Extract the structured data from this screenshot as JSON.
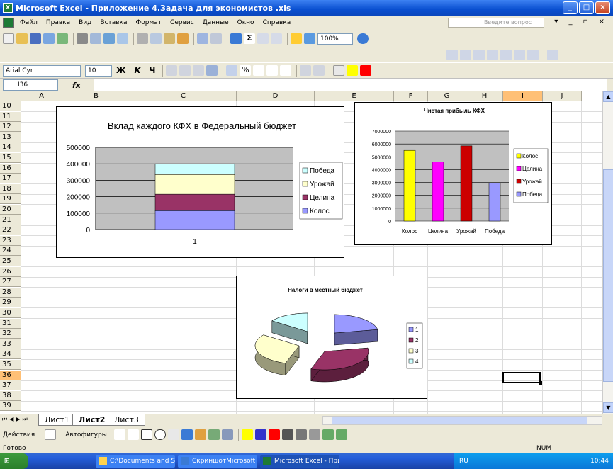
{
  "window": {
    "title": "Microsoft Excel - Приложение 4.Задача для экономистов .xls"
  },
  "menu": {
    "items": [
      "Файл",
      "Правка",
      "Вид",
      "Вставка",
      "Формат",
      "Сервис",
      "Данные",
      "Окно",
      "Справка"
    ],
    "ask_placeholder": "Введите вопрос"
  },
  "toolbar": {
    "zoom": "100%",
    "font_name": "Arial Cyr",
    "font_size": "10",
    "bold": "Ж",
    "italic": "К",
    "underline": "Ч"
  },
  "formula_bar": {
    "cell_ref": "I36",
    "fx": "fx",
    "formula": ""
  },
  "columns": [
    "A",
    "B",
    "C",
    "D",
    "E",
    "F",
    "G",
    "H",
    "I",
    "J"
  ],
  "rows": [
    "10",
    "11",
    "12",
    "13",
    "14",
    "15",
    "16",
    "17",
    "18",
    "19",
    "20",
    "21",
    "22",
    "23",
    "24",
    "25",
    "26",
    "27",
    "28",
    "29",
    "30",
    "31",
    "32",
    "33",
    "34",
    "35",
    "36",
    "37",
    "38",
    "39"
  ],
  "selected_cell": {
    "column": "I",
    "row": "36"
  },
  "sheets": {
    "tabs": [
      "Лист1",
      "Лист2",
      "Лист3"
    ],
    "active": "Лист2"
  },
  "draw_bar": {
    "actions": "Действия",
    "autoshapes": "Автофигуры"
  },
  "status": {
    "ready": "Готово",
    "num": "NUM"
  },
  "taskbar": {
    "tasks": [
      "C:\\Documents and Set...",
      "СкриншотMicrosoft W...",
      "Microsoft Excel - Прил..."
    ],
    "lang": "RU",
    "clock": "10:44"
  },
  "chart_data": [
    {
      "type": "bar",
      "stacked": true,
      "title": "Вклад каждого КФХ в Федеральный бюджет",
      "categories": [
        "1"
      ],
      "series": [
        {
          "name": "Колос",
          "values": [
            115000
          ],
          "color": "#9999ff"
        },
        {
          "name": "Целина",
          "values": [
            100000
          ],
          "color": "#993366"
        },
        {
          "name": "Урожай",
          "values": [
            120000
          ],
          "color": "#ffffcc"
        },
        {
          "name": "Победа",
          "values": [
            65000
          ],
          "color": "#ccffff"
        }
      ],
      "ylim": [
        0,
        500000
      ],
      "yticks": [
        "0",
        "100000",
        "200000",
        "300000",
        "400000",
        "500000"
      ],
      "legend_order": [
        "Победа",
        "Урожай",
        "Целина",
        "Колос"
      ],
      "legend": "right"
    },
    {
      "type": "bar",
      "title": "Чистая прибыль КФХ",
      "categories": [
        "Колос",
        "Целина",
        "Урожай",
        "Победа"
      ],
      "values": [
        5500000,
        4600000,
        5850000,
        2950000
      ],
      "colors": [
        "#ffff00",
        "#ff00ff",
        "#cc0000",
        "#9999ff"
      ],
      "ylim": [
        0,
        7000000
      ],
      "yticks": [
        "0",
        "1000000",
        "2000000",
        "3000000",
        "4000000",
        "5000000",
        "6000000",
        "7000000"
      ],
      "legend": "right"
    },
    {
      "type": "pie",
      "title": "Налоги в местный бюджет",
      "labels": [
        "1",
        "2",
        "3",
        "4"
      ],
      "values": [
        0.22,
        0.33,
        0.3,
        0.15
      ],
      "colors": [
        "#9999ff",
        "#993366",
        "#ffffcc",
        "#ccffff"
      ],
      "legend": "right"
    }
  ]
}
